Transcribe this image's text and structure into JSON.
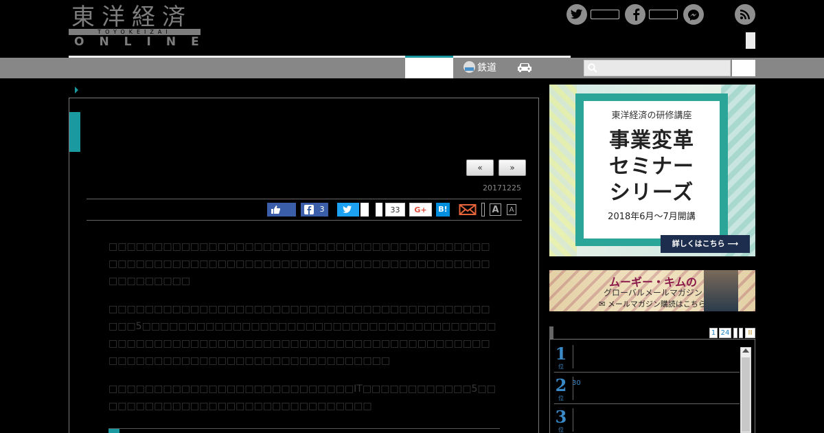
{
  "logo": {
    "jp": "東洋経済",
    "romaji": "TOYOKEIZAI",
    "online": "ONLINE"
  },
  "social": {
    "twitter_icon": "twitter-icon",
    "facebook_icon": "facebook-icon",
    "messenger_icon": "messenger-icon",
    "rss_icon": "rss-icon"
  },
  "nav": {
    "items": [
      {
        "label": "鉄道",
        "icon": "train-icon"
      },
      {
        "label": "",
        "icon": "car-icon"
      }
    ]
  },
  "search": {
    "placeholder": ""
  },
  "article": {
    "pager_prev": "«",
    "pager_next": "»",
    "date": "20171225",
    "share": {
      "facebook_count": "3",
      "hatena_count": "33",
      "gplus_label": "G+",
      "hatena_label": "B!",
      "font_large": "A",
      "font_small": "A"
    },
    "paragraphs": [
      "□□□□□□□□□□□□□□□□□□□□□□□□□□□□□□□□□□□□□□□□□□□□□□□□□□□□□□□□□□□□□□□□□□□□□□□□□□□□□□□□□□□□□□□□□□□□□",
      "□□□□□□□□□□□□□□□□□□□□□□□□□□□□□□□□□□□□□□□□□□□□□5□□□□□□□□□□□□□□□□□□□□□□□□□□□□□□□□□□□□□□□□□□□□□□□□□□□□□□□□□□□□□□□□□□□□□□□□□□□□□□□□□□□□□□□□□□□□□□□□□□□□□□□□□□□□□□□□",
      "□□□□□□□□□□□□□□□□□□□□□□□□□□□IT□□□□□□□□□□□□5□□□□□□□□□□□□□□□□□□□□□□□□□□□□□□□"
    ]
  },
  "ad1": {
    "title": "東洋経済の研修講座",
    "line1": "事業変革",
    "line2": "セミナー",
    "line3": "シリーズ",
    "period": "2018年6月〜7月開講",
    "cta": "詳しくはこちら ⟶"
  },
  "ad2": {
    "name": "ムーギー・キムの",
    "sub": "グローバルメールマガジン",
    "link": "✉ メールマガジン購読はこちら"
  },
  "ranking": {
    "tabs": [
      "1",
      "24",
      "",
      "",
      "II"
    ],
    "rows": [
      {
        "rank": "1",
        "sub": "位",
        "text": ""
      },
      {
        "rank": "2",
        "sub": "位",
        "text": "30"
      },
      {
        "rank": "3",
        "sub": "位",
        "text": ""
      }
    ]
  }
}
